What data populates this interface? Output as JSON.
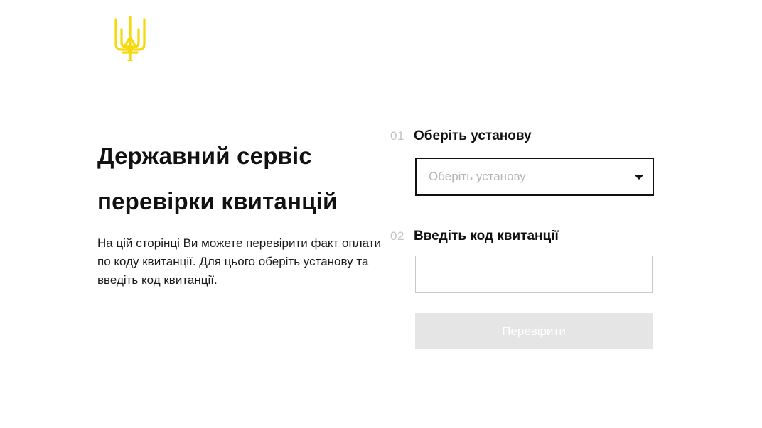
{
  "logo": {
    "icon": "trident-icon",
    "color": "#f5d90a"
  },
  "hero": {
    "title_line1": "Державний сервіс",
    "title_line2": "перевірки квитанцій",
    "description": "На цій сторінці Ви можете перевірити факт оплати по коду квитанції. Для цього оберіть установу та введіть код квитанції."
  },
  "form": {
    "step1": {
      "number": "01",
      "label": "Оберіть установу",
      "select_placeholder": "Оберіть установу"
    },
    "step2": {
      "number": "02",
      "label": "Введіть код квитанції",
      "input_value": ""
    },
    "submit_label": "Перевірити"
  },
  "colors": {
    "accent": "#f5d90a",
    "button_disabled_bg": "#e5e5e5",
    "step_number": "#c4c4c4"
  }
}
